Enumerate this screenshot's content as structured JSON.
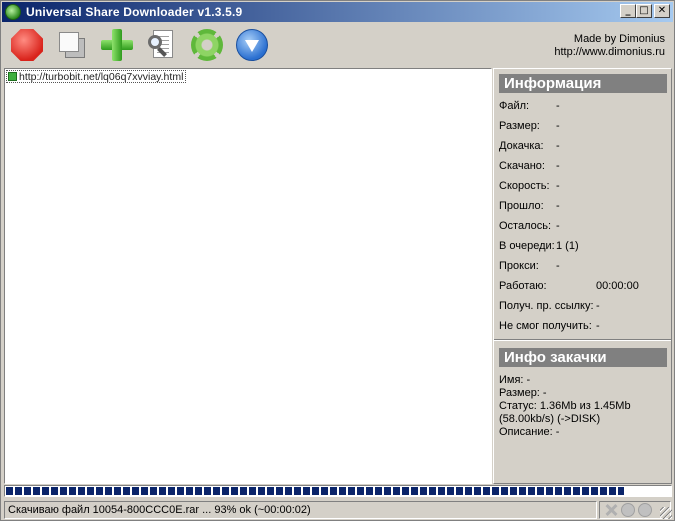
{
  "window": {
    "title": "Universal Share Downloader v1.3.5.9",
    "controls": {
      "minimize": "_",
      "maximize": "□",
      "close": "✕"
    }
  },
  "toolbar": {
    "buttons": [
      {
        "name": "stop-button",
        "icon": "stop-icon"
      },
      {
        "name": "copy-button",
        "icon": "copy-icon"
      },
      {
        "name": "add-button",
        "icon": "plus-icon"
      },
      {
        "name": "search-button",
        "icon": "search-icon"
      },
      {
        "name": "settings-button",
        "icon": "gear-icon"
      },
      {
        "name": "info-button",
        "icon": "info-icon"
      }
    ],
    "credits_line1": "Made by Dimonius",
    "credits_line2": "http://www.dimonius.ru"
  },
  "download_list": {
    "items": [
      {
        "url": "http://turbobit.net/lq06q7xvviay.html",
        "status_color": "#3fb03f"
      }
    ]
  },
  "info_panel": {
    "header": "Информация",
    "rows": [
      {
        "label": "Файл:",
        "value": "-"
      },
      {
        "label": "Размер:",
        "value": "-"
      },
      {
        "label": "Докачка:",
        "value": "-"
      },
      {
        "label": "Скачано:",
        "value": "-"
      },
      {
        "label": "Скорость:",
        "value": "-"
      },
      {
        "label": "Прошло:",
        "value": "-"
      },
      {
        "label": "Осталось:",
        "value": "-"
      },
      {
        "label": "В очереди:",
        "value": "1 (1)"
      },
      {
        "label": "Прокси:",
        "value": "-"
      },
      {
        "label": "Работаю:",
        "value": "00:00:00"
      },
      {
        "label": "Получ. пр. ссылку:",
        "value": "-"
      },
      {
        "label": "Не смог получить:",
        "value": "-"
      }
    ]
  },
  "download_info": {
    "header": "Инфо закачки",
    "name": "Имя: -",
    "size": "Размер: -",
    "status": "Статус: 1.36Mb из 1.45Mb (58.00kb/s) (->DISK)",
    "description": "Описание: -"
  },
  "progress": {
    "percent": 93,
    "bar_color": "#0a246a"
  },
  "statusbar": {
    "text": "Скачиваю файл 10054-800CCC0E.rar ... 93% ok (~00:00:02)"
  }
}
